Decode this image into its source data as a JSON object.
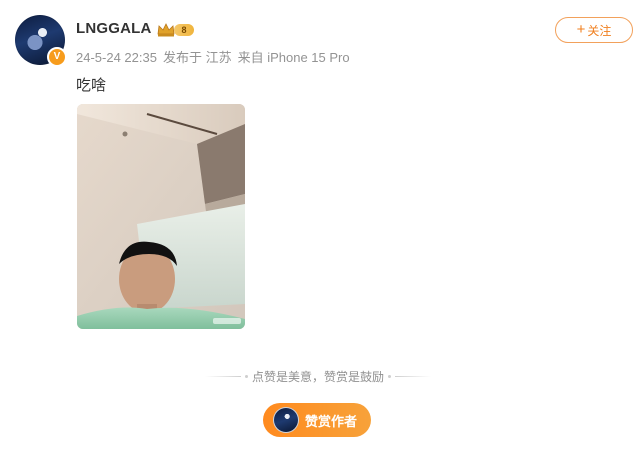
{
  "post": {
    "author": "LNGGALA",
    "vip_level": "8",
    "verified_mark": "V",
    "date": "24-5-24 22:35",
    "location": "发布于 江苏",
    "device": "来自 iPhone 15 Pro",
    "follow_label": "关注",
    "text": "吃啥"
  },
  "reward": {
    "hint": "点赞是美意，赞赏是鼓励",
    "button_label": "赞赏作者"
  },
  "colors": {
    "accent": "#f07f1f",
    "reward_gradient_start": "#ff8a1e",
    "reward_gradient_end": "#f7a23a"
  },
  "icons": {
    "follow": "plus-icon",
    "crown": "crown-icon"
  }
}
